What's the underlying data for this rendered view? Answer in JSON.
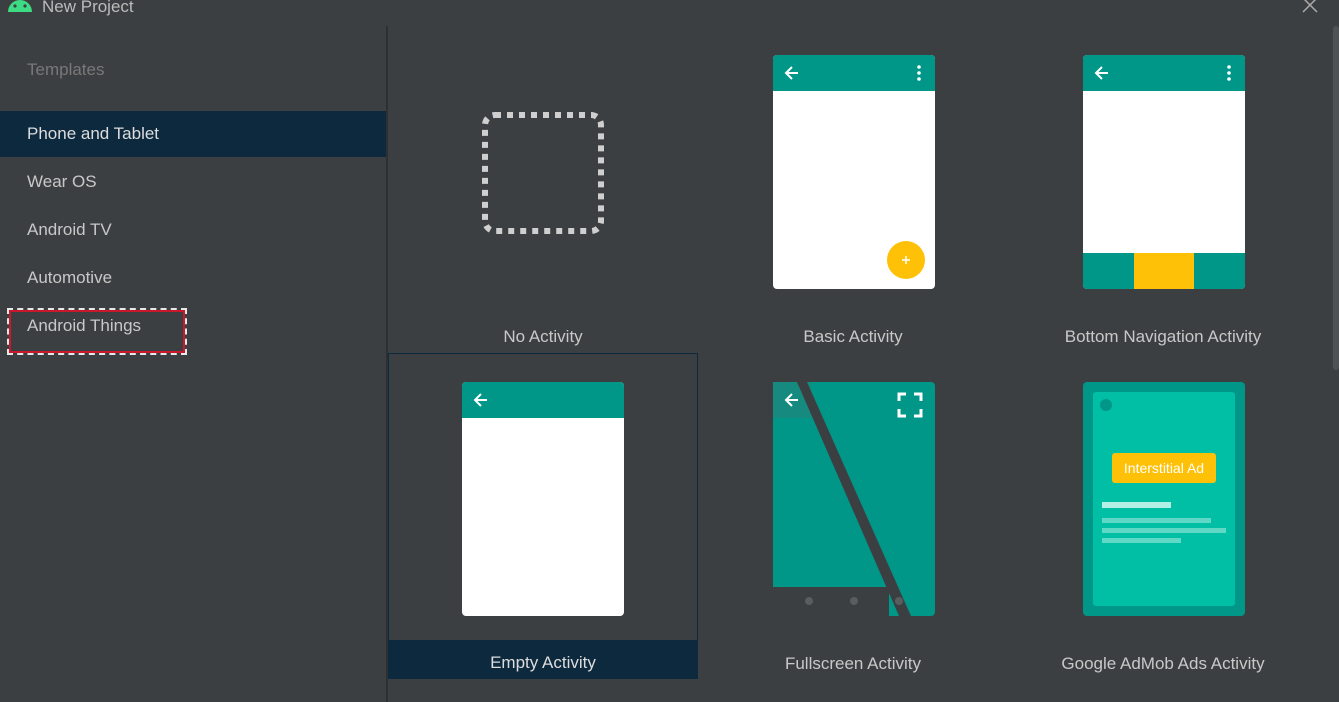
{
  "window": {
    "title": "New Project"
  },
  "sidebar": {
    "header": "Templates",
    "items": [
      {
        "label": "Phone and Tablet",
        "selected": true
      },
      {
        "label": "Wear OS",
        "selected": false
      },
      {
        "label": "Android TV",
        "selected": false
      },
      {
        "label": "Automotive",
        "selected": false
      },
      {
        "label": "Android Things",
        "selected": false,
        "focused": true
      }
    ]
  },
  "templates": [
    {
      "label": "No Activity",
      "selected": false
    },
    {
      "label": "Basic Activity",
      "selected": false
    },
    {
      "label": "Bottom Navigation Activity",
      "selected": false
    },
    {
      "label": "Empty Activity",
      "selected": true
    },
    {
      "label": "Fullscreen Activity",
      "selected": false
    },
    {
      "label": "Google AdMob Ads Activity",
      "selected": false
    }
  ],
  "admob": {
    "ad_label": "Interstitial Ad"
  },
  "colors": {
    "accent_teal": "#009688",
    "teal_light": "#00bfa5",
    "fab_yellow": "#ffc107",
    "selection": "#0d293e",
    "background": "#3c3f41"
  }
}
